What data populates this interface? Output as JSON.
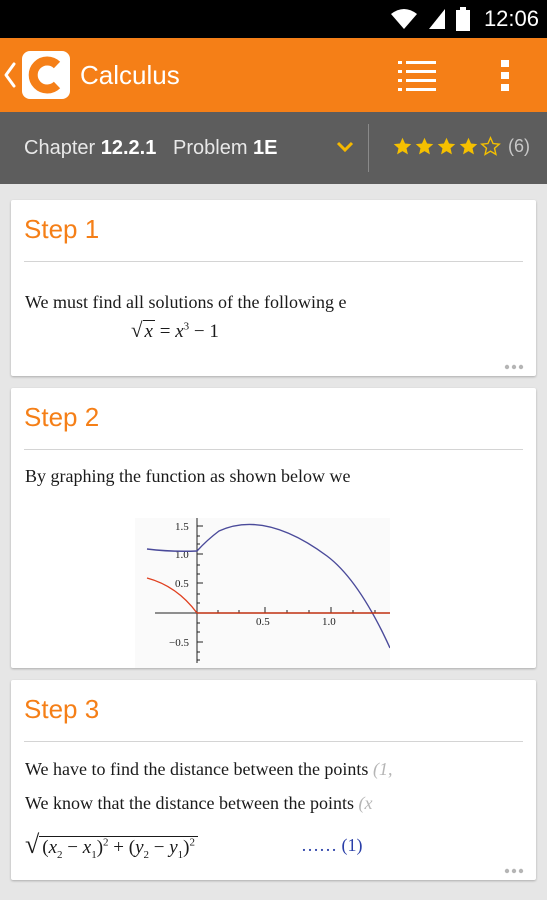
{
  "status_bar": {
    "time": "12:06"
  },
  "app_bar": {
    "title": "Calculus",
    "logo_letter": "C",
    "accent": "#f57f17"
  },
  "chapter_bar": {
    "chapter_label": "Chapter",
    "chapter_number": "12.2.1",
    "problem_label": "Problem",
    "problem_number": "1E",
    "rating_stars": 4,
    "rating_max": 5,
    "rating_count": "(6)"
  },
  "steps": [
    {
      "title": "Step 1",
      "text": "We must find all solutions of the following e",
      "formula": {
        "radicand": "x",
        "rhs_base": "x",
        "rhs_exp": "3",
        "rhs_tail": " − 1"
      }
    },
    {
      "title": "Step 2",
      "text": "By graphing the function as shown below we",
      "graph": {
        "y_ticks": [
          "1.5",
          "1.0",
          "0.5",
          "−0.5"
        ],
        "x_ticks": [
          "0.5",
          "1.0"
        ]
      }
    },
    {
      "title": "Step 3",
      "line1": "We have to find the distance between the points",
      "line1_tail": "(1,",
      "line2": "We know that the distance between the points",
      "line2_tail": "(x",
      "eq_label": "…… (1)"
    }
  ]
}
